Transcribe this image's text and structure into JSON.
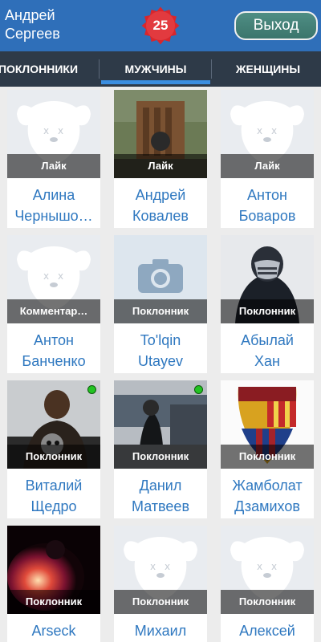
{
  "header": {
    "first_name": "Андрей",
    "last_name": "Сергеев",
    "badge_count": "25",
    "logout_label": "Выход"
  },
  "tabs": [
    {
      "label": "ПОКЛОННИКИ"
    },
    {
      "label": "МУЖЧИНЫ",
      "active": true
    },
    {
      "label": "ЖЕНЩИНЫ"
    }
  ],
  "cards": [
    {
      "status": "Лайк",
      "first": "Алина",
      "last": "Чернышо…",
      "photo": "placeholder-dog"
    },
    {
      "status": "Лайк",
      "first": "Андрей",
      "last": "Ковалев",
      "photo": "photo"
    },
    {
      "status": "Лайк",
      "first": "Антон",
      "last": "Боваров",
      "photo": "placeholder-dog"
    },
    {
      "status": "Комментар…",
      "first": "Антон",
      "last": "Банченко",
      "photo": "placeholder-dog"
    },
    {
      "status": "Поклонник",
      "first": "To'lqin",
      "last": "Utayev",
      "photo": "camera-placeholder"
    },
    {
      "status": "Поклонник",
      "first": "Абылай",
      "last": "Хан",
      "photo": "photo"
    },
    {
      "status": "Поклонник",
      "first": "Виталий",
      "last": "Щедро",
      "photo": "photo",
      "online": true
    },
    {
      "status": "Поклонник",
      "first": "Данил",
      "last": "Матвеев",
      "photo": "photo",
      "online": true
    },
    {
      "status": "Поклонник",
      "first": "Жамболат",
      "last": "Дзамихов",
      "photo": "photo"
    },
    {
      "status": "Поклонник",
      "first": "Arseck",
      "last": "",
      "photo": "photo"
    },
    {
      "status": "Поклонник",
      "first": "Михаил",
      "last": "",
      "photo": "placeholder-dog"
    },
    {
      "status": "Поклонник",
      "first": "Алексей",
      "last": "",
      "photo": "placeholder-dog"
    }
  ],
  "colors": {
    "header": "#2f6fb9",
    "badge": "#d8262c",
    "logout": "#4a8a80",
    "tabs": "#2e3a48",
    "active_tab": "#3b8ee0",
    "name_link": "#2f78c0",
    "online": "#22c322"
  }
}
